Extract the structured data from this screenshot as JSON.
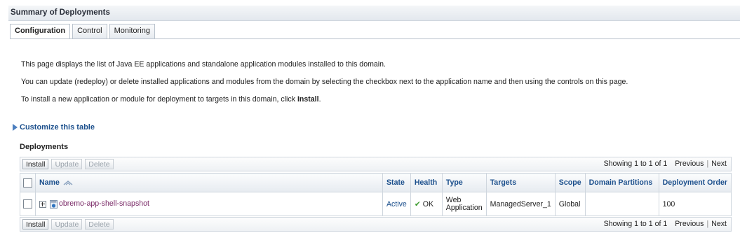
{
  "title": "Summary of Deployments",
  "tabs": [
    {
      "label": "Configuration",
      "active": true
    },
    {
      "label": "Control",
      "active": false
    },
    {
      "label": "Monitoring",
      "active": false
    }
  ],
  "intro": {
    "line1": "This page displays the list of Java EE applications and standalone application modules installed to this domain.",
    "line2": "You can update (redeploy) or delete installed applications and modules from the domain by selecting the checkbox next to the application name and then using the controls on this page.",
    "line3_prefix": "To install a new application or module for deployment to targets in this domain, click ",
    "line3_bold": "Install",
    "line3_suffix": "."
  },
  "customize_label": "Customize this table",
  "section_title": "Deployments",
  "toolbar": {
    "install": "Install",
    "update": "Update",
    "delete": "Delete",
    "showing": "Showing 1 to 1 of 1",
    "previous": "Previous",
    "next": "Next"
  },
  "columns": {
    "name": "Name",
    "state": "State",
    "health": "Health",
    "type": "Type",
    "targets": "Targets",
    "scope": "Scope",
    "domain_partitions": "Domain Partitions",
    "deployment_order": "Deployment Order"
  },
  "rows": [
    {
      "name": "obremo-app-shell-snapshot",
      "state": "Active",
      "health": "OK",
      "type_line1": "Web",
      "type_line2": "Application",
      "targets": "ManagedServer_1",
      "scope": "Global",
      "domain_partitions": "",
      "deployment_order": "100"
    }
  ],
  "icons": {
    "customize": "expand-triangle-icon",
    "sort": "sort-icon",
    "expand": "plus-expander-icon",
    "app": "web-app-icon",
    "health_ok": "checkmark-icon"
  },
  "colors": {
    "link_blue": "#1b4f8c",
    "app_link": "#7a2a67",
    "ok_green": "#3c9b2f"
  }
}
